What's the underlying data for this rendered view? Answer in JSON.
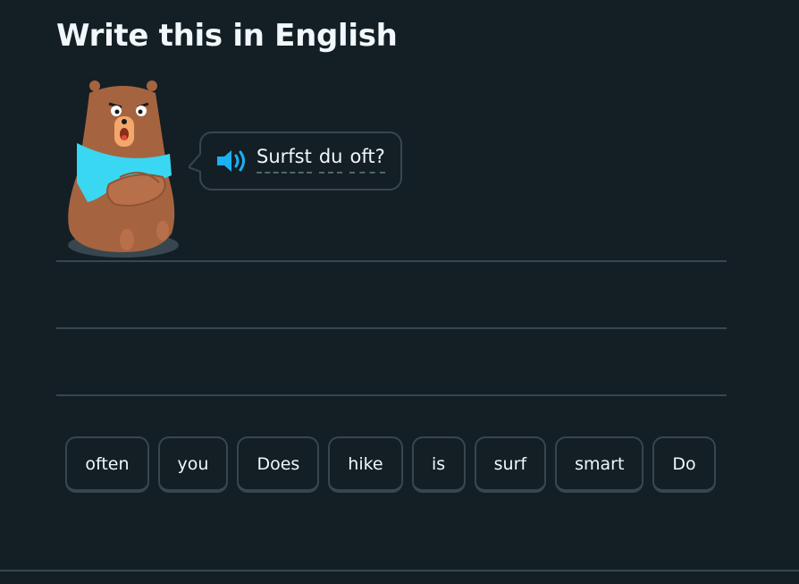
{
  "header": {
    "title": "Write this in English"
  },
  "prompt": {
    "words": [
      "Surfst",
      "du",
      "oft?"
    ],
    "speaker_icon": "speaker-icon",
    "character_icon": "bear-character"
  },
  "word_bank": [
    "often",
    "you",
    "Does",
    "hike",
    "is",
    "surf",
    "smart",
    "Do"
  ],
  "colors": {
    "background": "#131f24",
    "border": "#37464f",
    "text": "#f1f7fb",
    "speaker": "#1cb0f6",
    "bear_fur": "#a5643f",
    "scarf": "#3ad7f2"
  }
}
